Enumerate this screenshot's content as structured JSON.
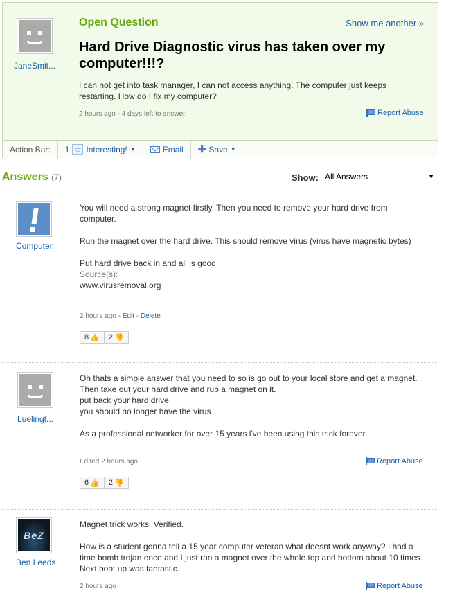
{
  "question": {
    "asker": "JaneSmit...",
    "type_label": "Open Question",
    "show_another": "Show me another »",
    "title": "Hard Drive Diagnostic virus has taken over my computer!!!?",
    "body": "I can not get into task manager, I can not access anything. The computer just keeps restarting. How do I fix my computer?",
    "meta": "2 hours ago - 4 days left to answer.",
    "report_abuse": "Report Abuse"
  },
  "action_bar": {
    "label": "Action Bar:",
    "interesting_count": "1",
    "interesting_label": "Interesting!",
    "email_label": "Email",
    "save_label": "Save"
  },
  "answers_header": {
    "title": "Answers",
    "count": "(7)",
    "show_label": "Show:",
    "show_selected": "All Answers"
  },
  "answers": [
    {
      "user": "Computer...",
      "paragraphs": [
        "You will need a strong magnet firstly, Then you need to remove your hard drive from computer.",
        "Run the magnet over the hard drive. This should remove virus (virus have magnetic bytes)",
        "Put hard drive back in and all is good."
      ],
      "source_label": "Source(s):",
      "source": "www.virusremoval.org",
      "meta_time": "2 hours ago",
      "edit": "Edit",
      "delete": "Delete",
      "thumbs_up": "8",
      "thumbs_down": "2"
    },
    {
      "user": "Luelingt...",
      "lines": [
        "Oh thats a simple answer that you need to so is go out to your local store and get a magnet.",
        "Then take out your hard drive and rub a magnet on it.",
        "put back your hard drive",
        "you should no longer have the virus"
      ],
      "paragraph2": "As a professional networker for over 15 years i've been using this trick forever.",
      "meta": "Edited 2 hours ago",
      "report_abuse": "Report Abuse",
      "thumbs_up": "6",
      "thumbs_down": "2"
    },
    {
      "user": "Ben Leeds",
      "logo_text": "BeZ",
      "para1": "Magnet trick works. Verified.",
      "para2": "How is a student gonna tell a 15 year computer veteran what doesnt work anyway? I had a time bomb trojan once and I just ran a magnet over the whole top and bottom about 10 times. Next boot up was fantastic.",
      "meta": "2 hours ago",
      "report_abuse": "Report Abuse"
    }
  ]
}
